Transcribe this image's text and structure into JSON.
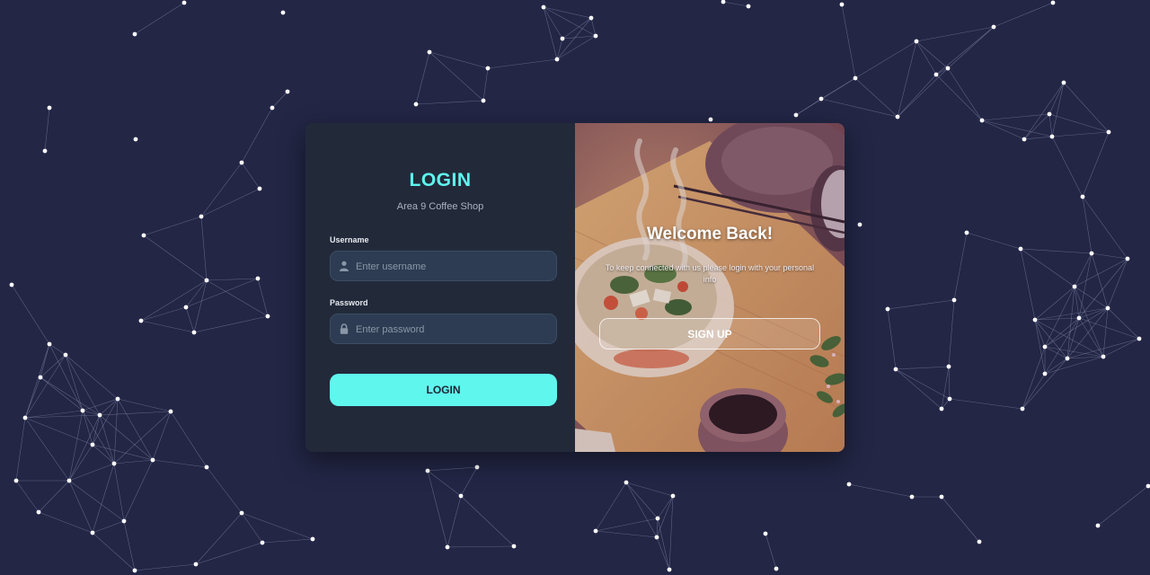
{
  "colors": {
    "page_background": "#232645",
    "login_panel": "#222a3a",
    "accent": "#5ff6ee",
    "input_background": "#2d3c52"
  },
  "login": {
    "title": "LOGIN",
    "subtitle": "Area 9 Coffee Shop",
    "username": {
      "label": "Username",
      "placeholder": "Enter username",
      "value": "",
      "icon": "user-icon"
    },
    "password": {
      "label": "Password",
      "placeholder": "Enter password",
      "value": "",
      "icon": "lock-icon"
    },
    "button_label": "LOGIN"
  },
  "welcome": {
    "title": "Welcome Back!",
    "text": "To keep connected with us please login with your personal info",
    "button_label": "SIGN UP",
    "illustration": "cozy-meal-illustration"
  }
}
